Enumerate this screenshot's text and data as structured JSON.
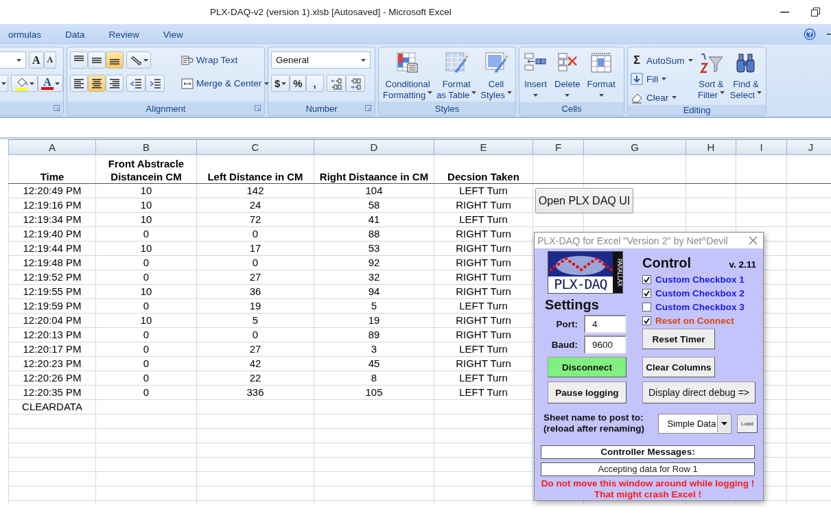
{
  "window": {
    "title": "PLX-DAQ-v2 (version 1).xlsb [Autosaved] - Microsoft Excel"
  },
  "ribbon_tabs": [
    {
      "label": "ormulas"
    },
    {
      "label": "Data"
    },
    {
      "label": "Review"
    },
    {
      "label": "View"
    }
  ],
  "font_group": {
    "grow_glyph": "A",
    "shrink_glyph": "A",
    "color_glyph": "A"
  },
  "alignment_group": {
    "label": "Alignment",
    "wrap_text": "Wrap Text",
    "merge_center": "Merge & Center",
    "vertical_align": [
      {
        "kind": "top",
        "selected": false
      },
      {
        "kind": "middle",
        "selected": false
      },
      {
        "kind": "bottom",
        "selected": true
      }
    ],
    "horizontal_align": [
      {
        "kind": "left",
        "selected": false
      },
      {
        "kind": "center",
        "selected": true
      },
      {
        "kind": "right",
        "selected": false
      }
    ]
  },
  "number_group": {
    "label": "Number",
    "format": "General",
    "currency": "$",
    "percent": "%",
    "comma": ","
  },
  "styles_group": {
    "label": "Styles",
    "buttons": [
      {
        "kind": "conditional",
        "lines": [
          "Conditional",
          "Formatting"
        ]
      },
      {
        "kind": "table",
        "lines": [
          "Format",
          "as Table"
        ]
      },
      {
        "kind": "cellstyles",
        "lines": [
          "Cell",
          "Styles"
        ]
      }
    ]
  },
  "cells_group": {
    "label": "Cells",
    "buttons": [
      {
        "kind": "insert",
        "label": "Insert"
      },
      {
        "kind": "delete",
        "label": "Delete"
      },
      {
        "kind": "format",
        "label": "Format"
      }
    ]
  },
  "editing_group": {
    "label": "Editing",
    "small_buttons": [
      {
        "kind": "autosum",
        "glyph": "Σ",
        "label": "AutoSum"
      },
      {
        "kind": "fill",
        "label": "Fill"
      },
      {
        "kind": "clear",
        "label": "Clear"
      }
    ],
    "big_buttons": [
      {
        "kind": "sort",
        "lines": [
          "Sort &",
          "Filter"
        ]
      },
      {
        "kind": "find",
        "lines": [
          "Find &",
          "Select"
        ]
      }
    ]
  },
  "sheet": {
    "columns": [
      "A",
      "B",
      "C",
      "D",
      "E",
      "F",
      "G",
      "H",
      "I",
      "J"
    ],
    "header_row": [
      "Time",
      "Front Abstracle Distancein CM",
      "Left Distance in CM",
      "Right Distaance in CM",
      "Decsion Taken"
    ],
    "rows": [
      [
        "12:20:49 PM",
        "10",
        "142",
        "104",
        "LEFT Turn"
      ],
      [
        "12:19:16 PM",
        "10",
        "24",
        "58",
        "RIGHT Turn"
      ],
      [
        "12:19:34 PM",
        "10",
        "72",
        "41",
        "LEFT Turn"
      ],
      [
        "12:19:40 PM",
        "0",
        "0",
        "88",
        "RIGHT Turn"
      ],
      [
        "12:19:44 PM",
        "10",
        "17",
        "53",
        "RIGHT Turn"
      ],
      [
        "12:19:48 PM",
        "0",
        "0",
        "92",
        "RIGHT Turn"
      ],
      [
        "12:19:52 PM",
        "0",
        "27",
        "32",
        "RIGHT Turn"
      ],
      [
        "12:19:55 PM",
        "10",
        "36",
        "94",
        "RIGHT Turn"
      ],
      [
        "12:19:59 PM",
        "0",
        "19",
        "5",
        "LEFT Turn"
      ],
      [
        "12:20:04 PM",
        "10",
        "5",
        "19",
        "RIGHT Turn"
      ],
      [
        "12:20:13 PM",
        "0",
        "0",
        "89",
        "RIGHT Turn"
      ],
      [
        "12:20:17 PM",
        "0",
        "27",
        "3",
        "LEFT Turn"
      ],
      [
        "12:20:23 PM",
        "0",
        "42",
        "45",
        "RIGHT Turn"
      ],
      [
        "12:20:26 PM",
        "0",
        "22",
        "8",
        "LEFT Turn"
      ],
      [
        "12:20:35 PM",
        "0",
        "336",
        "105",
        "LEFT Turn"
      ],
      [
        "CLEARDATA"
      ]
    ]
  },
  "open_button": {
    "label": "Open PLX DAQ UI"
  },
  "dialog": {
    "title": "PLX-DAQ for Excel \"Version 2\" by Net^Devil",
    "logo_text": "PLX-DAQ",
    "logo_side_text": "PARALLAX",
    "settings_heading": "Settings",
    "control_heading": "Control",
    "version": "v. 2.11",
    "port": {
      "label": "Port:",
      "value": "4"
    },
    "baud": {
      "label": "Baud:",
      "value": "9600"
    },
    "checkboxes": [
      {
        "kind": "custom",
        "label": "Custom Checkbox 1",
        "checked": true
      },
      {
        "kind": "custom",
        "label": "Custom Checkbox 2",
        "checked": true
      },
      {
        "kind": "custom",
        "label": "Custom Checkbox 3",
        "checked": false
      },
      {
        "kind": "reset",
        "label": "Reset on Connect",
        "checked": true
      }
    ],
    "buttons": [
      {
        "kind": "reset_timer",
        "label": "Reset Timer",
        "highlighted": false
      },
      {
        "kind": "connect",
        "label": "Disconnect",
        "highlighted": true
      },
      {
        "kind": "clear_columns",
        "label": "Clear Columns",
        "highlighted": false
      },
      {
        "kind": "pause",
        "label": "Pause logging",
        "highlighted": false
      },
      {
        "kind": "debug",
        "label": "Display direct debug =>",
        "highlighted": false
      }
    ],
    "sheet_label": [
      "Sheet name to post to:",
      "(reload after renaming)"
    ],
    "sheet_select": "Simple Data",
    "load_button": "Load",
    "messages_heading": "Controller Messages:",
    "message": "Accepting data for Row 1",
    "warning": [
      "Do not move this window around while logging !",
      "That might crash Excel !"
    ]
  }
}
